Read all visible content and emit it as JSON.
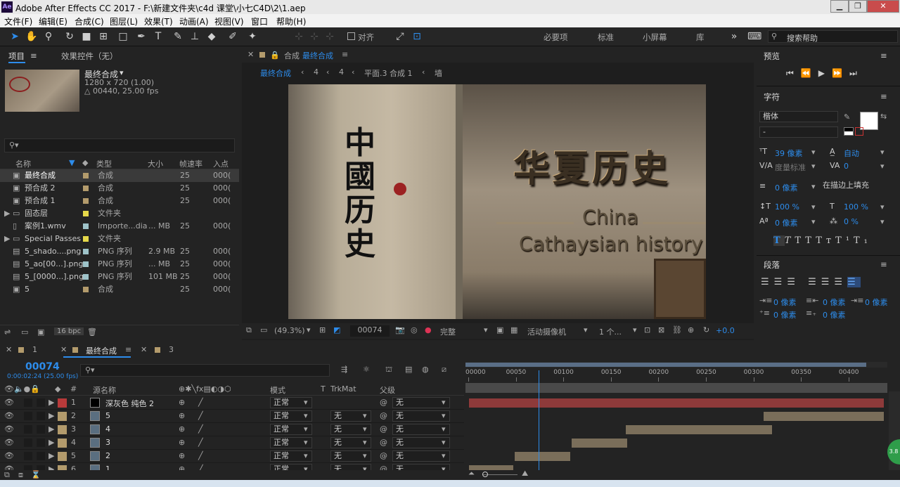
{
  "window": {
    "title": "Adobe After Effects CC 2017 - F:\\新建文件夹\\c4d 课堂\\小七C4D\\2\\1.aep",
    "app_icon": "Ae"
  },
  "menu": [
    "文件(F)",
    "编辑(E)",
    "合成(C)",
    "图层(L)",
    "效果(T)",
    "动画(A)",
    "视图(V)",
    "窗口",
    "帮助(H)"
  ],
  "toolbar": {
    "snap_label": "对齐",
    "workspaces": [
      "必要项",
      "标准",
      "小屏幕",
      "库"
    ],
    "search_placeholder": "搜索帮助"
  },
  "project": {
    "tab_project": "项目",
    "tab_effects": "效果控件（无）",
    "selected_name": "最终合成",
    "selected_info1": "1280 x 720 (1.00)",
    "selected_info2": "△ 00440, 25.00 fps",
    "columns": [
      "名称",
      "类型",
      "大小",
      "帧速率",
      "入点"
    ],
    "items": [
      {
        "name": "最终合成",
        "type": "合成",
        "size": "",
        "fps": "25",
        "in": "000(",
        "color": "#b39b6c",
        "icon": "comp"
      },
      {
        "name": "预合成 2",
        "type": "合成",
        "size": "",
        "fps": "25",
        "in": "000(",
        "color": "#b39b6c",
        "icon": "comp"
      },
      {
        "name": "预合成 1",
        "type": "合成",
        "size": "",
        "fps": "25",
        "in": "000(",
        "color": "#b39b6c",
        "icon": "comp"
      },
      {
        "name": "固态层",
        "type": "文件夹",
        "size": "",
        "fps": "",
        "in": "",
        "color": "#e5d84a",
        "icon": "folder"
      },
      {
        "name": "案例1.wmv",
        "type": "Importe...dia",
        "size": "... MB",
        "fps": "25",
        "in": "000(",
        "color": "#9ec3c9",
        "icon": "file"
      },
      {
        "name": "Special Passes",
        "type": "文件夹",
        "size": "",
        "fps": "",
        "in": "",
        "color": "#e5d84a",
        "icon": "folder"
      },
      {
        "name": "5_shado....png",
        "type": "PNG 序列",
        "size": "2.9 MB",
        "fps": "25",
        "in": "000(",
        "color": "#9ec3c9",
        "icon": "seq"
      },
      {
        "name": "5_ao[00...].png",
        "type": "PNG 序列",
        "size": "... MB",
        "fps": "25",
        "in": "000(",
        "color": "#9ec3c9",
        "icon": "seq"
      },
      {
        "name": "5_[0000...].png",
        "type": "PNG 序列",
        "size": "101 MB",
        "fps": "25",
        "in": "000(",
        "color": "#9ec3c9",
        "icon": "seq"
      },
      {
        "name": "5",
        "type": "合成",
        "size": "",
        "fps": "25",
        "in": "000(",
        "color": "#b39b6c",
        "icon": "comp"
      }
    ],
    "bpc": "16 bpc"
  },
  "viewer": {
    "tab": "合成",
    "tab_name": "最终合成",
    "breadcrumbs": [
      "最终合成",
      "4",
      "4",
      "平面.3 合成 1",
      "墙"
    ],
    "zoom": "(49.3%)",
    "timecode": "00074",
    "quality": "完整",
    "camera": "活动摄像机",
    "views": "1 个...",
    "exposure": "+0.0",
    "canvas_text": {
      "title_cn": "华夏历史",
      "line1": "China",
      "line2": "Cathaysian history"
    }
  },
  "preview": {
    "title": "预览"
  },
  "character": {
    "title": "字符",
    "font": "楷体",
    "style": "-",
    "size": "39 像素",
    "leading": "自动",
    "kerning": "度量标准",
    "tracking": "0",
    "stroke": "0 像素",
    "stroke_mode": "在描边上填充",
    "vscale": "100 %",
    "hscale": "100 %",
    "baseline": "0 像素",
    "tsume": "0 %",
    "fill_color": "#ffffff"
  },
  "paragraph": {
    "title": "段落",
    "indent_left": "0 像素",
    "indent_first": "0 像素",
    "space_before": "0 像素",
    "space_after": "0 像素",
    "indent_right": "0 像素"
  },
  "timeline": {
    "tabs": [
      "1",
      "最终合成",
      "3"
    ],
    "timecode": "00074",
    "time_sub": "0:00:02:24 (25.00 fps)",
    "col_source": "源名称",
    "col_mode": "模式",
    "col_t": "T",
    "col_trkmat": "TrkMat",
    "col_parent": "父级",
    "ruler": [
      "00000",
      "00050",
      "00100",
      "00150",
      "00200",
      "00250",
      "00300",
      "00350",
      "00400"
    ],
    "ruler_max": 440,
    "playhead": 74,
    "layers": [
      {
        "num": "1",
        "name": "深灰色 纯色 2",
        "mode": "正常",
        "trk": "",
        "parent": "无",
        "color": "#b83a3a",
        "start": 0,
        "end": 440,
        "barcolor": "#8e3a3a"
      },
      {
        "num": "2",
        "name": "5",
        "mode": "正常",
        "trk": "无",
        "parent": "无",
        "color": "#b39b6c",
        "start": 310,
        "end": 440,
        "barcolor": "#7a6e5a"
      },
      {
        "num": "3",
        "name": "4",
        "mode": "正常",
        "trk": "无",
        "parent": "无",
        "color": "#b39b6c",
        "start": 165,
        "end": 320,
        "barcolor": "#7a6e5a"
      },
      {
        "num": "4",
        "name": "3",
        "mode": "正常",
        "trk": "无",
        "parent": "无",
        "color": "#b39b6c",
        "start": 108,
        "end": 168,
        "barcolor": "#7a6e5a"
      },
      {
        "num": "5",
        "name": "2",
        "mode": "正常",
        "trk": "无",
        "parent": "无",
        "color": "#b39b6c",
        "start": 48,
        "end": 108,
        "barcolor": "#7a6e5a"
      },
      {
        "num": "6",
        "name": "1",
        "mode": "正常",
        "trk": "无",
        "parent": "无",
        "color": "#b39b6c",
        "start": 0,
        "end": 48,
        "barcolor": "#7a6e5a"
      }
    ]
  }
}
